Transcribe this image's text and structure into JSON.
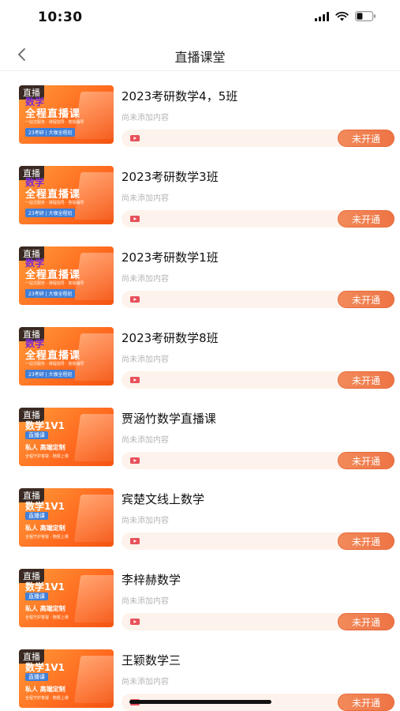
{
  "status_bar": {
    "time": "10:30"
  },
  "nav": {
    "title": "直播课堂"
  },
  "courses": [
    {
      "title": "2023考研数学4，5班",
      "subtitle": "尚未添加内容",
      "status": "未开通",
      "thumb": {
        "tag": "直播",
        "line1": "数学",
        "line2": "全程直播课",
        "line3": "一站式服务 · 课程指导 · 答疑辅导",
        "line4": "23考研 | 大咖全程班"
      }
    },
    {
      "title": "2023考研数学3班",
      "subtitle": "尚未添加内容",
      "status": "未开通",
      "thumb": {
        "tag": "直播",
        "line1": "数学",
        "line2": "全程直播课",
        "line3": "一站式服务 · 课程指导 · 答疑辅导",
        "line4": "23考研 | 大咖全程班"
      }
    },
    {
      "title": "2023考研数学1班",
      "subtitle": "尚未添加内容",
      "status": "未开通",
      "thumb": {
        "tag": "直播",
        "line1": "数学",
        "line2": "全程直播课",
        "line3": "一站式服务 · 课程指导 · 答疑辅导",
        "line4": "23考研 | 大咖全程班"
      }
    },
    {
      "title": "2023考研数学8班",
      "subtitle": "尚未添加内容",
      "status": "未开通",
      "thumb": {
        "tag": "直播",
        "line1": "数学",
        "line2": "全程直播课",
        "line3": "一站式服务 · 课程指导 · 答疑辅导",
        "line4": "23考研 | 大咖全程班"
      }
    },
    {
      "title": "贾涵竹数学直播课",
      "subtitle": "尚未添加内容",
      "status": "未开通",
      "thumb": {
        "tag": "直播",
        "line1": "数学1V1",
        "line2": "直播课",
        "line3": "私人 高端定制",
        "line4": "全程守护答疑 · 随报上课"
      }
    },
    {
      "title": "宾楚文线上数学",
      "subtitle": "尚未添加内容",
      "status": "未开通",
      "thumb": {
        "tag": "直播",
        "line1": "数学1V1",
        "line2": "直播课",
        "line3": "私人 高端定制",
        "line4": "全程守护答疑 · 随报上课"
      }
    },
    {
      "title": "李梓赫数学",
      "subtitle": "尚未添加内容",
      "status": "未开通",
      "thumb": {
        "tag": "直播",
        "line1": "数学1V1",
        "line2": "直播课",
        "line3": "私人 高端定制",
        "line4": "全程守护答疑 · 随报上课"
      }
    },
    {
      "title": "王颖数学三",
      "subtitle": "尚未添加内容",
      "status": "未开通",
      "thumb": {
        "tag": "直播",
        "line1": "数学1V1",
        "line2": "直播课",
        "line3": "私人 高端定制",
        "line4": "全程守护答疑 · 随报上课"
      }
    }
  ],
  "colors": {
    "accent": "#ee7445",
    "bar_bg": "#fdf3ec",
    "thumb_orange": "#ff6a1f"
  }
}
